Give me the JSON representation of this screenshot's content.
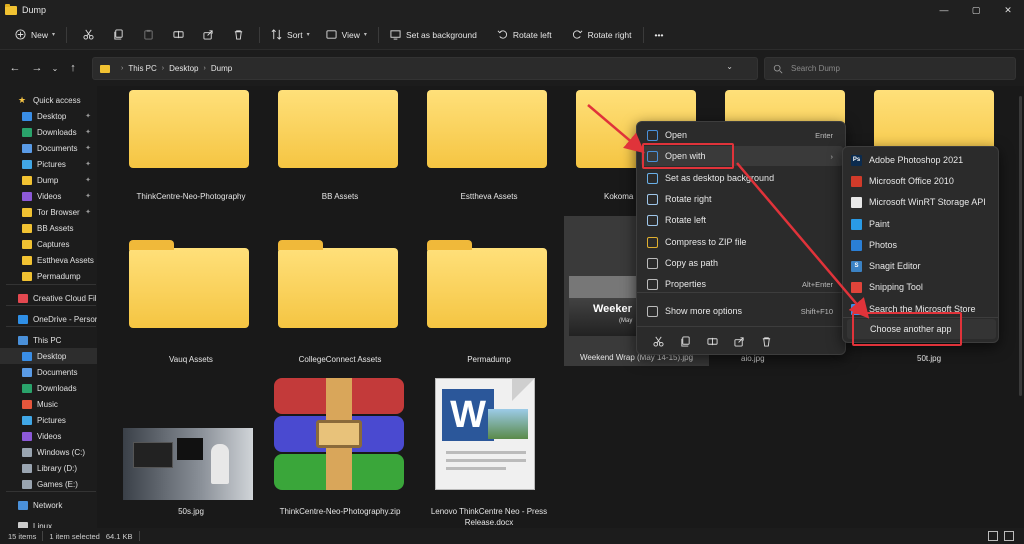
{
  "window": {
    "title": "Dump",
    "controls": [
      "—",
      "▢",
      "✕"
    ]
  },
  "toolbar": {
    "new_label": "New",
    "sort_label": "Sort",
    "view_label": "View",
    "set_bg_label": "Set as background",
    "rotate_left_label": "Rotate left",
    "rotate_right_label": "Rotate right",
    "more_label": "•••"
  },
  "address": {
    "crumbs": [
      "This PC",
      "Desktop",
      "Dump"
    ],
    "search_placeholder": "Search Dump"
  },
  "sidebar": {
    "items": [
      {
        "label": "Quick access",
        "icon": "star-icon",
        "color": "#f6c445"
      },
      {
        "label": "Desktop",
        "icon": "desktop-icon",
        "color": "#3a8ee6",
        "pinned": "✦"
      },
      {
        "label": "Downloads",
        "icon": "download-icon",
        "color": "#2aa36b",
        "pinned": "✦"
      },
      {
        "label": "Documents",
        "icon": "document-icon",
        "color": "#5a9be6",
        "pinned": "✦"
      },
      {
        "label": "Pictures",
        "icon": "pictures-icon",
        "color": "#41a7e6",
        "pinned": "✦"
      },
      {
        "label": "Dump",
        "icon": "folder-icon",
        "color": "#f1c232",
        "pinned": "✦"
      },
      {
        "label": "Videos",
        "icon": "videos-icon",
        "color": "#8d5ad8",
        "pinned": "✦"
      },
      {
        "label": "Tor Browser",
        "icon": "folder-icon",
        "color": "#f1c232",
        "pinned": "✦"
      },
      {
        "label": "BB Assets",
        "icon": "folder-icon",
        "color": "#f1c232"
      },
      {
        "label": "Captures",
        "icon": "folder-icon",
        "color": "#f1c232"
      },
      {
        "label": "Esttheva Assets",
        "icon": "folder-icon",
        "color": "#f1c232"
      },
      {
        "label": "Permadump",
        "icon": "folder-icon",
        "color": "#f1c232"
      },
      {
        "label": "Creative Cloud Fil",
        "icon": "creative-cloud-icon",
        "color": "#e34850"
      },
      {
        "label": "OneDrive - Persor",
        "icon": "onedrive-icon",
        "color": "#2f8fe6"
      },
      {
        "label": "This PC",
        "icon": "pc-icon",
        "color": "#4a90d9"
      },
      {
        "label": "Desktop",
        "icon": "desktop-icon",
        "color": "#3a8ee6"
      },
      {
        "label": "Documents",
        "icon": "document-icon",
        "color": "#5a9be6"
      },
      {
        "label": "Downloads",
        "icon": "download-icon",
        "color": "#2aa36b"
      },
      {
        "label": "Music",
        "icon": "music-icon",
        "color": "#e6563c"
      },
      {
        "label": "Pictures",
        "icon": "pictures-icon",
        "color": "#41a7e6"
      },
      {
        "label": "Videos",
        "icon": "videos-icon",
        "color": "#8d5ad8"
      },
      {
        "label": "Windows (C:)",
        "icon": "drive-icon",
        "color": "#9aa5b1"
      },
      {
        "label": "Library (D:)",
        "icon": "drive-icon",
        "color": "#9aa5b1"
      },
      {
        "label": "Games (E:)",
        "icon": "drive-icon",
        "color": "#9aa5b1"
      },
      {
        "label": "Network",
        "icon": "network-icon",
        "color": "#4a90d9"
      },
      {
        "label": "Linux",
        "icon": "linux-icon",
        "color": "#cccccc"
      }
    ]
  },
  "files": {
    "row1": [
      "ThinkCentre-Neo-Photography",
      "BB Assets",
      "Esttheva Assets",
      "Kokoma"
    ],
    "row2": [
      "Vauq Assets",
      "CollegeConnect Assets",
      "Permadump",
      "Weekend Wrap (May 14-15).jpg",
      "aio.jpg",
      "50t.jpg"
    ],
    "row3": [
      "50s.jpg",
      "ThinkCentre-Neo-Photography.zip",
      "Lenovo ThinkCentre Neo - Press Release.docx"
    ],
    "weekend_overlay": "Weeker",
    "weekend_overlay2": "(May",
    "word_letter": "W"
  },
  "context_menu": {
    "items": [
      {
        "label": "Open",
        "shortcut": "Enter",
        "icon": "open-icon"
      },
      {
        "label": "Open with",
        "shortcut": "›",
        "icon": "open-with-icon"
      },
      {
        "label": "Set as desktop background",
        "shortcut": "",
        "icon": "set-background-icon"
      },
      {
        "label": "Rotate right",
        "shortcut": "",
        "icon": "rotate-right-icon"
      },
      {
        "label": "Rotate left",
        "shortcut": "",
        "icon": "rotate-left-icon"
      },
      {
        "label": "Compress to ZIP file",
        "shortcut": "",
        "icon": "zip-icon"
      },
      {
        "label": "Copy as path",
        "shortcut": "",
        "icon": "copy-path-icon"
      },
      {
        "label": "Properties",
        "shortcut": "Alt+Enter",
        "icon": "properties-icon"
      },
      {
        "label": "Show more options",
        "shortcut": "Shift+F10",
        "icon": "more-options-icon"
      }
    ]
  },
  "open_with_menu": {
    "items": [
      {
        "label": "Adobe Photoshop 2021",
        "icon": "photoshop-icon",
        "color": "#0b2b4e",
        "glyph": "Ps"
      },
      {
        "label": "Microsoft Office 2010",
        "icon": "office-icon",
        "color": "#d13b2a",
        "glyph": ""
      },
      {
        "label": "Microsoft WinRT Storage API",
        "icon": "winrt-icon",
        "color": "#e8e8e8",
        "glyph": ""
      },
      {
        "label": "Paint",
        "icon": "paint-icon",
        "color": "#2a9be6",
        "glyph": ""
      },
      {
        "label": "Photos",
        "icon": "photos-icon",
        "color": "#2a7fd6",
        "glyph": ""
      },
      {
        "label": "Snagit Editor",
        "icon": "snagit-icon",
        "color": "#3b82c4",
        "glyph": "S"
      },
      {
        "label": "Snipping Tool",
        "icon": "snipping-icon",
        "color": "#e0443a",
        "glyph": ""
      },
      {
        "label": "Search the Microsoft Store",
        "icon": "store-icon",
        "color": "#3a8ee6",
        "glyph": ""
      },
      {
        "label": "Choose another app",
        "icon": "",
        "color": "",
        "glyph": ""
      }
    ]
  },
  "status": {
    "items": "15 items",
    "selected": "1 item selected",
    "size": "64.1 KB"
  }
}
